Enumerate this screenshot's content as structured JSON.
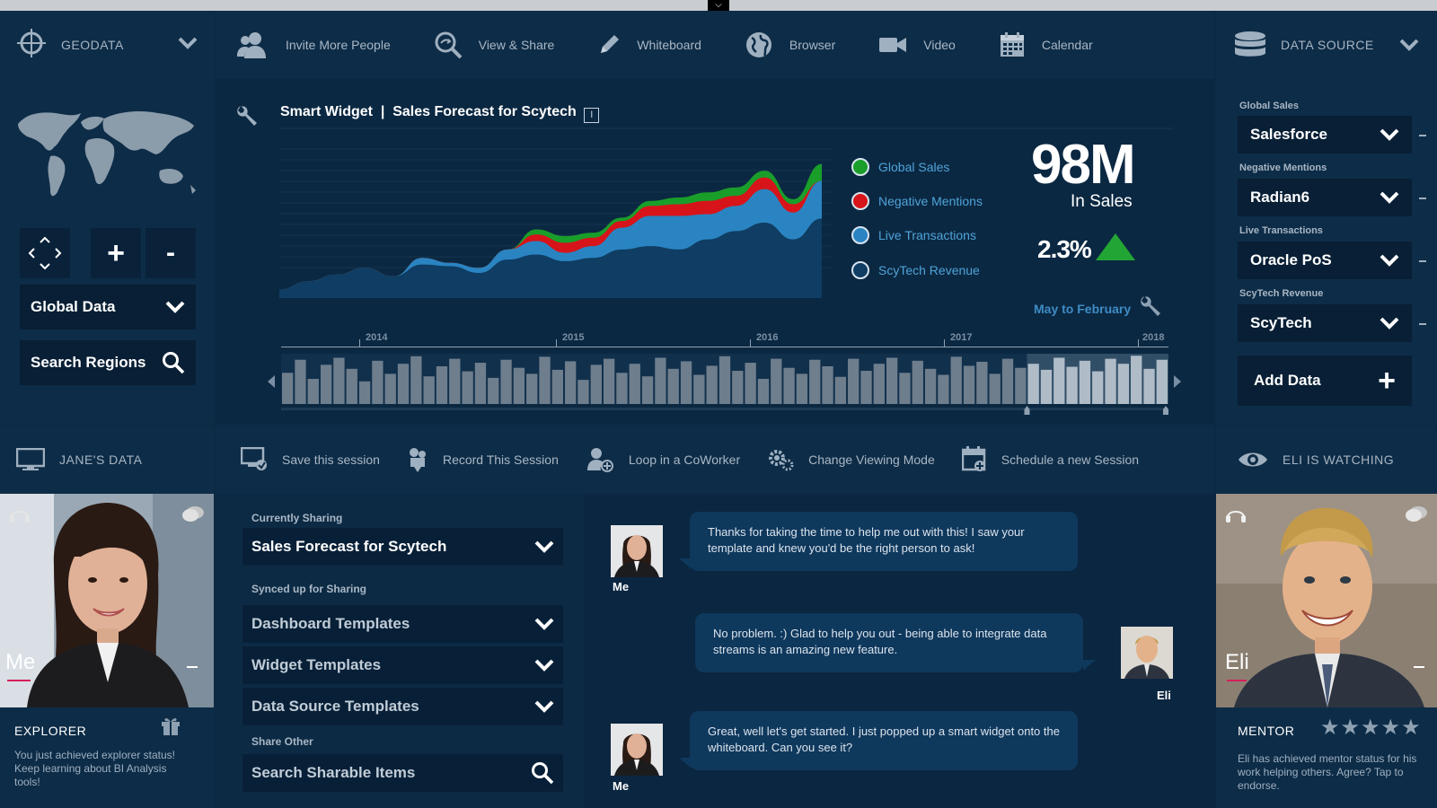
{
  "colors": {
    "background": "#0c2a44",
    "global_sales": "#1a9e2a",
    "negative_mentions": "#d7141a",
    "live_transactions": "#2a84c2",
    "scytech_revenue": "#0f3d63",
    "up_arrow": "#23a535",
    "accent_pink": "#d61f5b"
  },
  "geodata": {
    "label": "GEODATA",
    "icon": "crosshair-icon",
    "region_select": "Global Data",
    "search_regions": "Search Regions"
  },
  "toolbar": {
    "items": [
      {
        "label": "Invite More People",
        "icon": "people-icon"
      },
      {
        "label": "View & Share",
        "icon": "magnify-share-icon"
      },
      {
        "label": "Whiteboard",
        "icon": "pencil-icon"
      },
      {
        "label": "Browser",
        "icon": "globe-icon"
      },
      {
        "label": "Video",
        "icon": "video-camera-icon"
      },
      {
        "label": "Calendar",
        "icon": "calendar-icon"
      }
    ]
  },
  "data_source": {
    "label": "DATA SOURCE",
    "icon": "database-icon",
    "sources": [
      {
        "label": "Global Sales",
        "value": "Salesforce"
      },
      {
        "label": "Negative Mentions",
        "value": "Radian6"
      },
      {
        "label": "Live Transactions",
        "value": "Oracle PoS"
      },
      {
        "label": "ScyTech Revenue",
        "value": "ScyTech"
      }
    ],
    "add_data": "Add Data"
  },
  "widget": {
    "title": "Smart Widget  |  Sales Forecast for Scytech",
    "legend": [
      "Global Sales",
      "Negative Mentions",
      "Live Transactions",
      "ScyTech Revenue"
    ],
    "kpi_value": "98M",
    "kpi_label": "In Sales",
    "kpi_change": "2.3%",
    "range_label": "May to February",
    "timeline_years": [
      "2014",
      "2015",
      "2016",
      "2017",
      "2018"
    ]
  },
  "chart_data": {
    "type": "area",
    "title": "",
    "xlabel": "",
    "ylabel": "",
    "series": [
      {
        "name": "ScyTech Revenue",
        "values": [
          10,
          20,
          28,
          36,
          26,
          40,
          38,
          30,
          46,
          52,
          44,
          48,
          58,
          62,
          58,
          70,
          80,
          90,
          70,
          95
        ]
      },
      {
        "name": "Live Transactions",
        "values": [
          0,
          0,
          0,
          0,
          0,
          8,
          4,
          6,
          12,
          16,
          10,
          14,
          26,
          36,
          40,
          30,
          30,
          40,
          32,
          45
        ]
      },
      {
        "name": "Negative Mentions",
        "values": [
          0,
          0,
          0,
          0,
          0,
          0,
          0,
          0,
          0,
          8,
          12,
          10,
          8,
          12,
          14,
          16,
          12,
          14,
          10,
          0
        ]
      },
      {
        "name": "Global Sales",
        "values": [
          0,
          0,
          0,
          0,
          0,
          0,
          0,
          0,
          0,
          6,
          8,
          6,
          4,
          6,
          8,
          10,
          10,
          8,
          6,
          20
        ]
      }
    ]
  },
  "timeline": {
    "bars": [
      0.62,
      0.88,
      0.5,
      0.78,
      0.92,
      0.7,
      0.45,
      0.86,
      0.6,
      0.8,
      0.95,
      0.55,
      0.75,
      0.9,
      0.65,
      0.82,
      0.52,
      0.88,
      0.72,
      0.6,
      0.94,
      0.68,
      0.85,
      0.48,
      0.78,
      0.9,
      0.62,
      0.8,
      0.55,
      0.92,
      0.7,
      0.85,
      0.58,
      0.76,
      0.95,
      0.66,
      0.82,
      0.5,
      0.9,
      0.72,
      0.6,
      0.88,
      0.75,
      0.54,
      0.9,
      0.66,
      0.8,
      0.92,
      0.62,
      0.86,
      0.7,
      0.58,
      0.94,
      0.76,
      0.84,
      0.6,
      0.9,
      0.72,
      0.8,
      0.68,
      0.92,
      0.74,
      0.86,
      0.65,
      0.9,
      0.8,
      0.96,
      0.7,
      0.88
    ],
    "selected_from_index": 58
  },
  "janes_data": {
    "label": "JANE'S DATA",
    "name": "Me",
    "status_title": "EXPLORER",
    "status_text": "You just achieved explorer status!  Keep learning about BI Analysis tools!"
  },
  "session_toolbar": {
    "items": [
      {
        "label": "Save this session",
        "icon": "monitor-save-icon"
      },
      {
        "label": "Record This Session",
        "icon": "film-camera-icon"
      },
      {
        "label": "Loop in a CoWorker",
        "icon": "add-person-icon"
      },
      {
        "label": "Change Viewing Mode",
        "icon": "gears-icon"
      },
      {
        "label": "Schedule a new Session",
        "icon": "calendar-add-icon"
      }
    ]
  },
  "eli": {
    "label": "ELI IS WATCHING",
    "name": "Eli",
    "status_title": "MENTOR",
    "rating_stars": 5,
    "status_text": "Eli has achieved mentor status for his work helping others. Agree?  Tap to endorse."
  },
  "sharing": {
    "currently_label": "Currently Sharing",
    "currently_value": "Sales Forecast for Scytech",
    "synced_label": "Synced up for Sharing",
    "synced_items": [
      "Dashboard Templates",
      "Widget Templates",
      "Data Source Templates"
    ],
    "other_label": "Share Other",
    "search_placeholder": "Search Sharable Items"
  },
  "chat": {
    "messages": [
      {
        "sender": "Me",
        "text": "Thanks for taking the time to help me out with this!  I saw your template and knew you'd be the right person to ask!"
      },
      {
        "sender": "Eli",
        "text": "No problem.  :)  Glad to help you out - being able to integrate data streams is an amazing new feature."
      },
      {
        "sender": "Me",
        "text": "Great, well let's get started.  I just popped up a smart widget onto the whiteboard.  Can you see it?"
      }
    ]
  }
}
